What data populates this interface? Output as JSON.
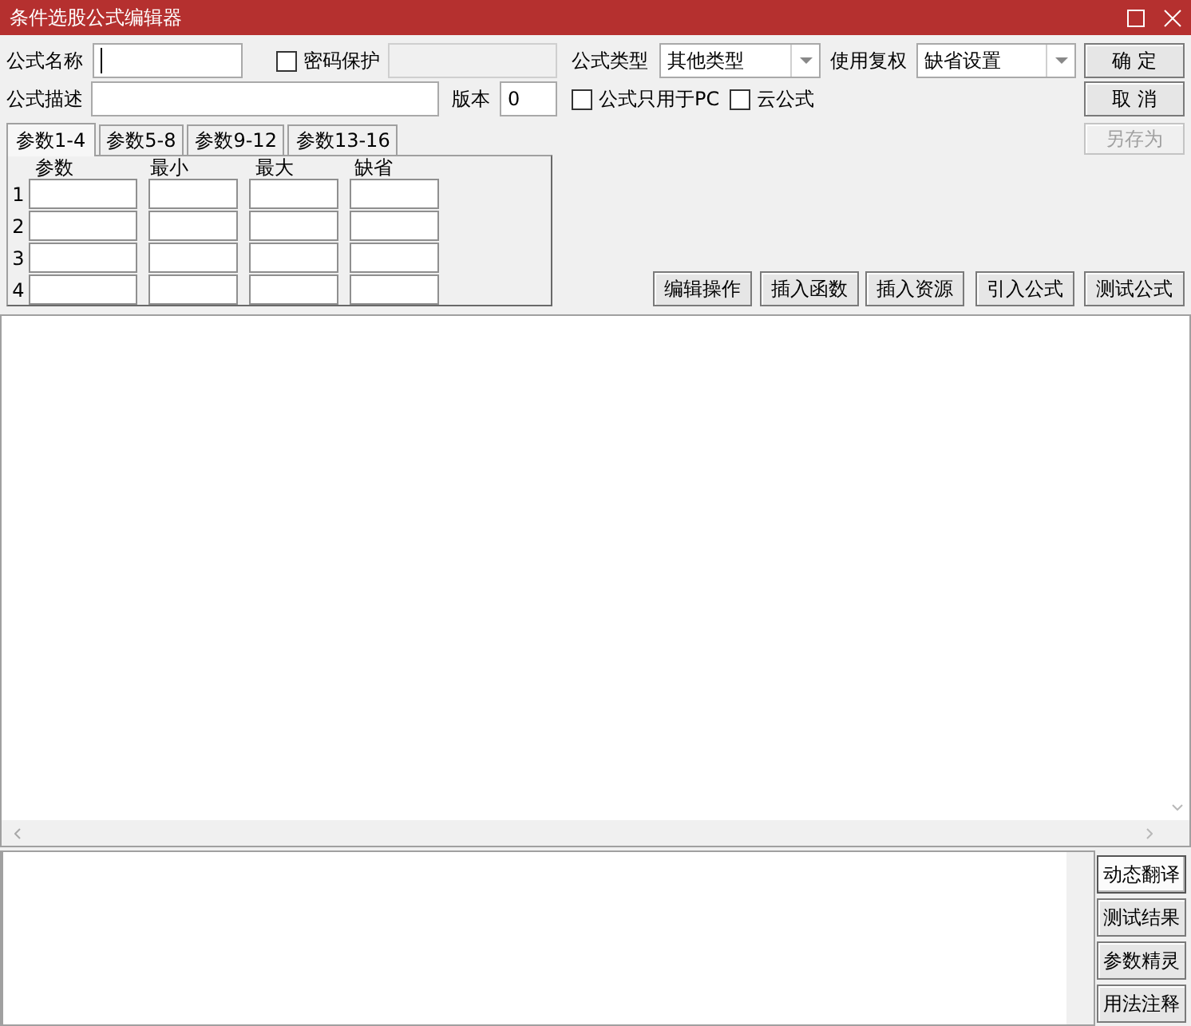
{
  "window": {
    "title": "条件选股公式编辑器"
  },
  "form": {
    "name": {
      "label": "公式名称",
      "focused": true
    },
    "password": {
      "label": "密码保护",
      "checked": false,
      "field_disabled": true
    },
    "type": {
      "label": "公式类型",
      "value": "其他类型"
    },
    "adjust": {
      "label": "使用复权",
      "value": "缺省设置"
    },
    "description": {
      "label": "公式描述"
    },
    "version": {
      "label": "版本",
      "value": "0"
    },
    "pc_only": {
      "label": "公式只用于PC",
      "checked": false
    },
    "cloud": {
      "label": "云公式",
      "checked": false
    }
  },
  "side_buttons": [
    {
      "label": "确 定",
      "disabled": false
    },
    {
      "label": "取 消",
      "disabled": false
    },
    {
      "label": "另存为",
      "disabled": true
    }
  ],
  "param_tabs": [
    {
      "label": "参数1-4",
      "selected": true
    },
    {
      "label": "参数5-8",
      "selected": false
    },
    {
      "label": "参数9-12",
      "selected": false
    },
    {
      "label": "参数13-16",
      "selected": false
    }
  ],
  "param_table": {
    "columns": [
      "参数",
      "最小",
      "最大",
      "缺省"
    ],
    "rows": [
      "1",
      "2",
      "3",
      "4"
    ]
  },
  "toolbar_buttons": [
    "编辑操作",
    "插入函数",
    "插入资源",
    "引入公式",
    "测试公式"
  ],
  "output_buttons": [
    {
      "label": "动态翻译",
      "selected": true
    },
    {
      "label": "测试结果",
      "selected": false
    },
    {
      "label": "参数精灵",
      "selected": false
    },
    {
      "label": "用法注释",
      "selected": false
    }
  ]
}
